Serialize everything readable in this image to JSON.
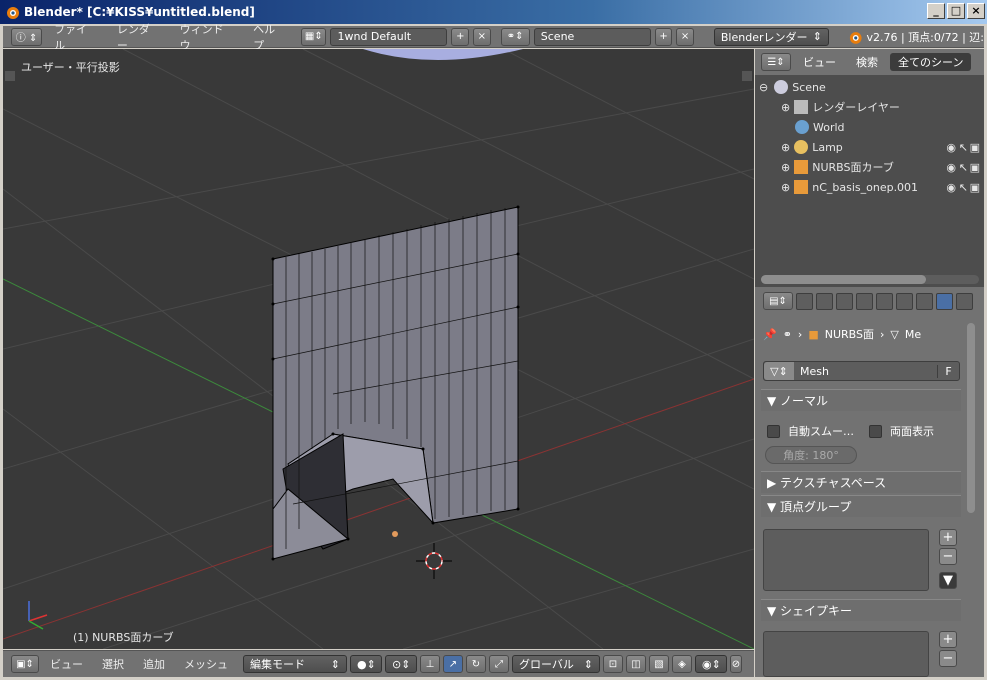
{
  "window": {
    "title": "Blender* [C:¥KISS¥untitled.blend]",
    "minimize": "_",
    "maximize": "□",
    "close": "×"
  },
  "topbar": {
    "menus": [
      "ファイル",
      "レンダー",
      "ウィンドウ",
      "ヘルプ"
    ],
    "layout": "1wnd Default",
    "scene": "Scene",
    "engine": "Blenderレンダー",
    "stats": "v2.76 | 頂点:0/72 | 辺:"
  },
  "viewport": {
    "label": "ユーザー・平行投影",
    "object_label": "(1) NURBS面カーブ"
  },
  "bottombar": {
    "menus": [
      "ビュー",
      "選択",
      "追加",
      "メッシュ"
    ],
    "mode": "編集モード",
    "orientation": "グローバル"
  },
  "outliner": {
    "tabs": [
      "ビュー",
      "検索",
      "全てのシーン"
    ],
    "items": [
      {
        "label": "Scene"
      },
      {
        "label": "レンダーレイヤー"
      },
      {
        "label": "World"
      },
      {
        "label": "Lamp"
      },
      {
        "label": "NURBS面カーブ"
      },
      {
        "label": "nC_basis_onep.001"
      }
    ]
  },
  "properties": {
    "crumb_object": "NURBS面",
    "crumb_data": "Me",
    "mesh_name": "Mesh",
    "fake_user": "F",
    "panels": {
      "normals": "▼ ノーマル",
      "auto_smooth": "自動スムー…",
      "double_sided": "両面表示",
      "angle": "角度:  180°",
      "texture_space": "▶ テクスチャスペース",
      "vertex_groups": "▼ 頂点グループ",
      "shape_keys": "▼ シェイプキー"
    }
  },
  "colors": {
    "viewport_bg": "#393939",
    "header": "#727272",
    "accent": "#4a6fa5",
    "title": "#0a246a"
  }
}
